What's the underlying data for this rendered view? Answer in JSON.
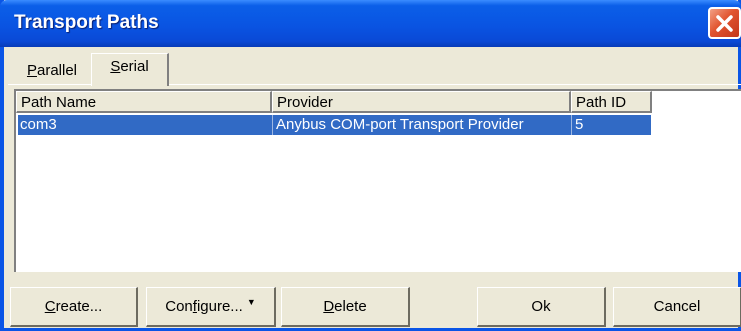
{
  "window": {
    "title": "Transport Paths"
  },
  "tabs": [
    {
      "label_access": "P",
      "label_rest": "arallel"
    },
    {
      "label_access": "S",
      "label_rest": "erial"
    }
  ],
  "list": {
    "columns": [
      "Path Name",
      "Provider",
      "Path ID"
    ],
    "rows": [
      {
        "path_name": "com3",
        "provider": "Anybus COM-port Transport Provider",
        "path_id": "5",
        "selected": true
      }
    ]
  },
  "buttons": {
    "create": {
      "access": "C",
      "rest": "reate..."
    },
    "configure": {
      "pre": "Con",
      "access": "f",
      "rest": "igure..."
    },
    "delete": {
      "access": "D",
      "rest": "elete"
    },
    "ok": "Ok",
    "cancel": "Cancel"
  },
  "colors": {
    "titlebar": "#0a54e2",
    "selection": "#316ac5",
    "dialog_bg": "#ece9d8",
    "close_button": "#e1542e"
  }
}
